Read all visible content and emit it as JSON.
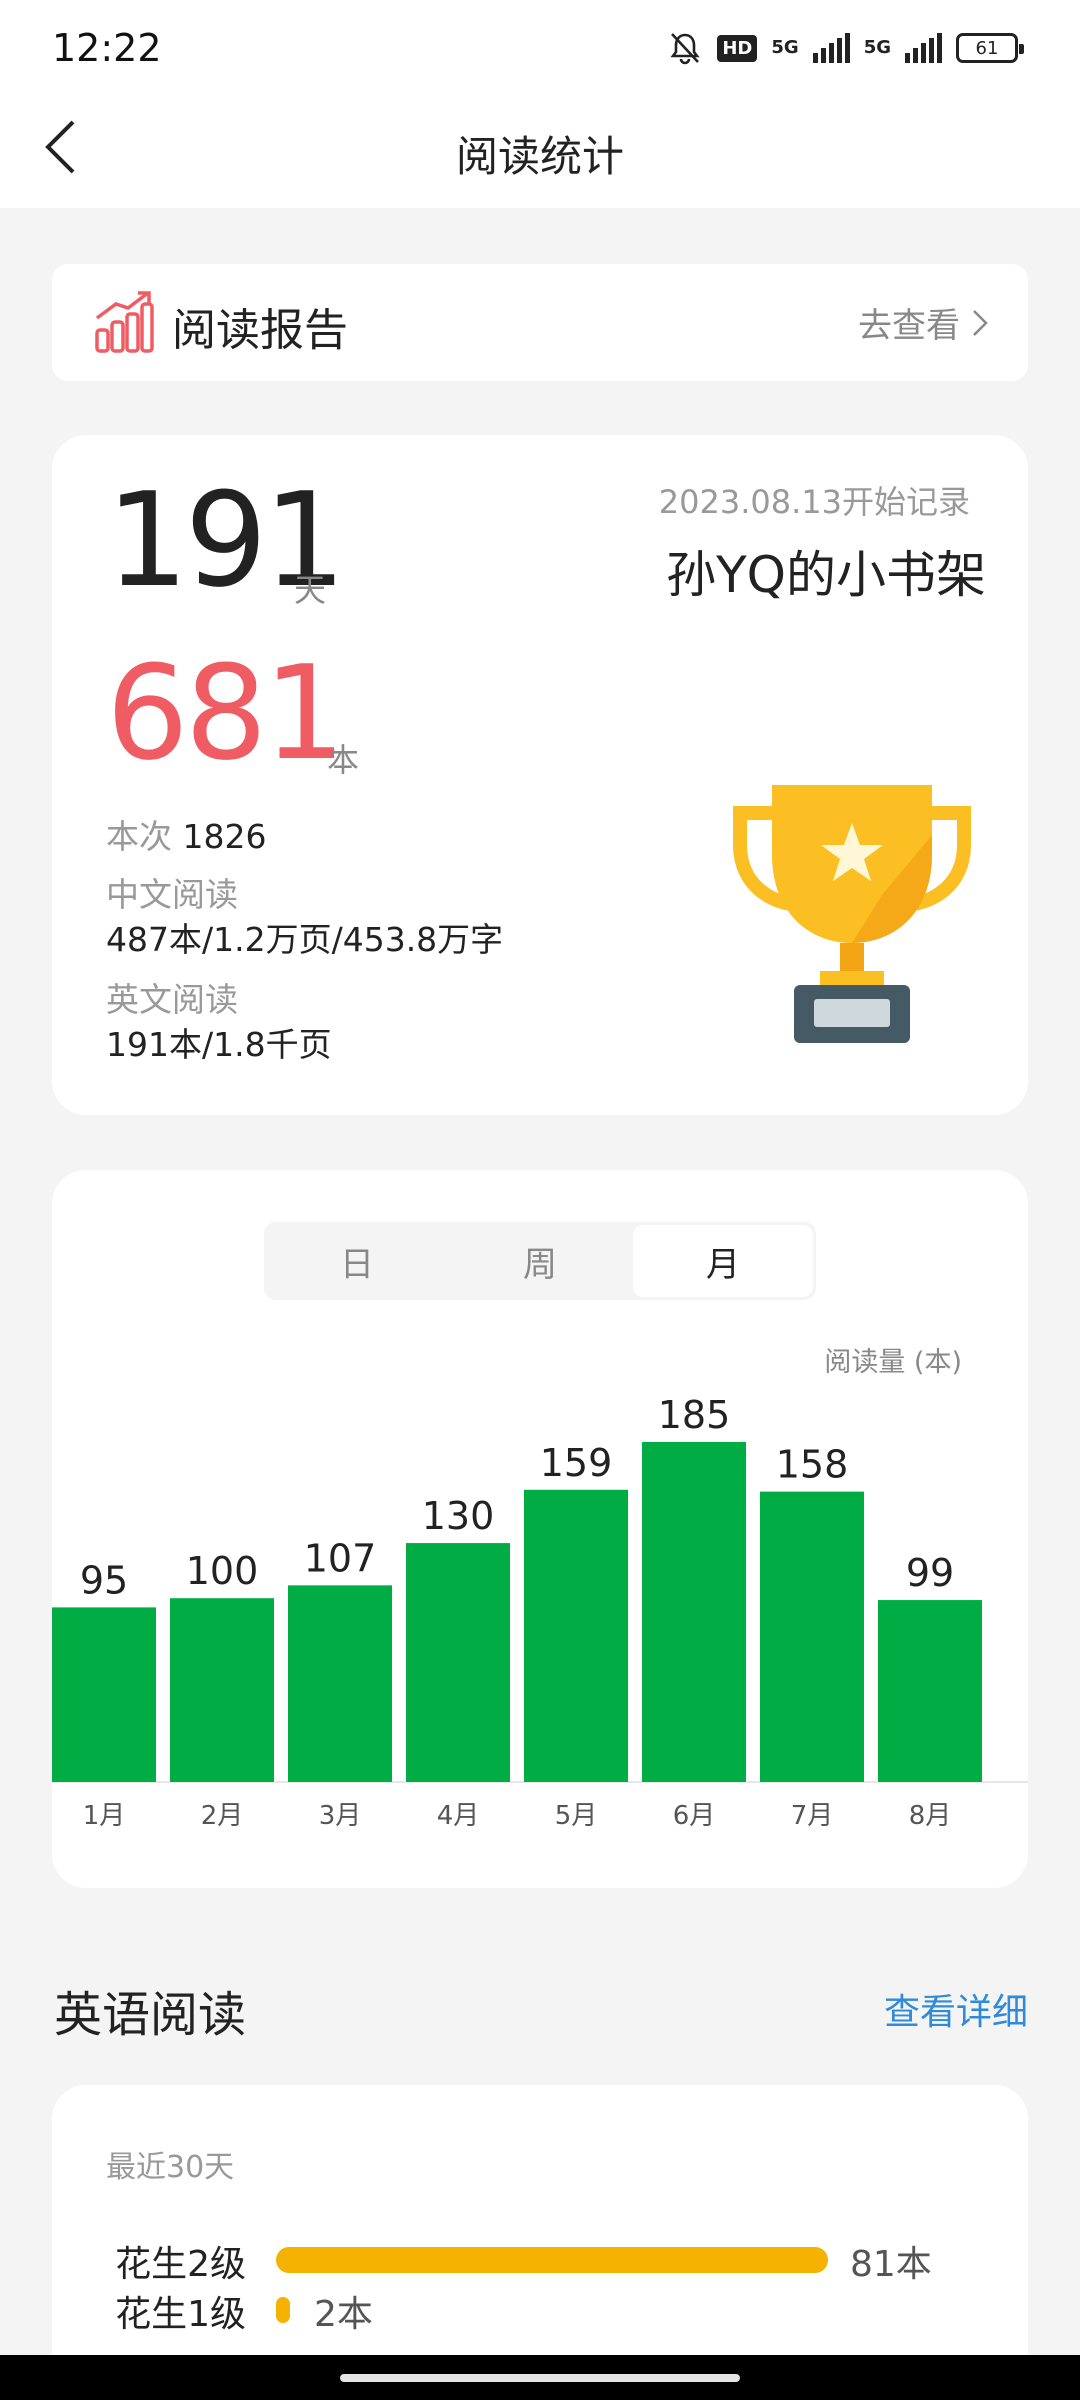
{
  "status": {
    "time": "12:22",
    "network1": "5G",
    "network2": "5G",
    "hd": "HD",
    "battery": "61"
  },
  "header": {
    "title": "阅读统计"
  },
  "report": {
    "label": "阅读报告",
    "link": "去查看"
  },
  "summary": {
    "days": "191",
    "days_unit": "天",
    "since": "2023.08.13开始记录",
    "shelf_name": "孙YQ的小书架",
    "books": "681",
    "books_unit": "本",
    "times_label": "本次",
    "times_value": "1826",
    "cn_label": "中文阅读",
    "cn_value": "487本/1.2万页/453.8万字",
    "en_label": "英文阅读",
    "en_value": "191本/1.8千页"
  },
  "period_tabs": [
    {
      "label": "日",
      "active": false
    },
    {
      "label": "周",
      "active": false
    },
    {
      "label": "月",
      "active": true
    }
  ],
  "chart_unit": "阅读量 (本)",
  "chart_data": {
    "type": "bar",
    "categories": [
      "1月",
      "2月",
      "3月",
      "4月",
      "5月",
      "6月",
      "7月",
      "8月"
    ],
    "values": [
      95,
      100,
      107,
      130,
      159,
      185,
      158,
      99
    ],
    "ylabel": "阅读量 (本)",
    "ylim": [
      0,
      185
    ],
    "color": "#00ad45",
    "grid": false
  },
  "english": {
    "title": "英语阅读",
    "link": "查看详细",
    "period": "最近30天",
    "levels": [
      {
        "label": "花生2级",
        "value": "81本",
        "count": 81
      },
      {
        "label": "花生1级",
        "value": "2本",
        "count": 2
      }
    ],
    "bar_color": "#f6b200"
  }
}
